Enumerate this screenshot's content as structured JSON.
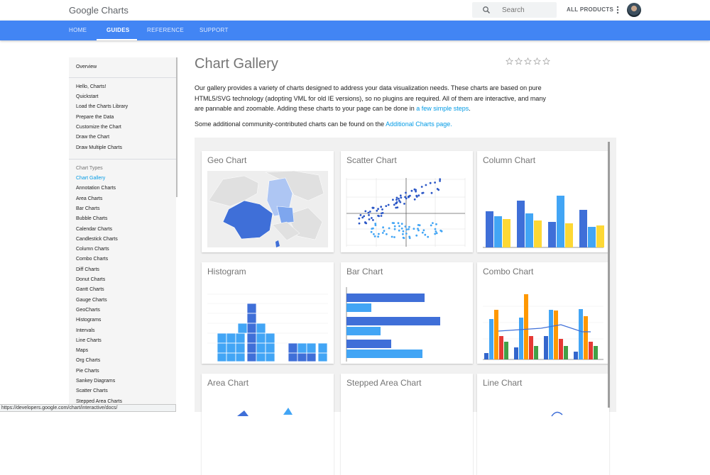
{
  "header": {
    "brand": "Google Charts",
    "search_placeholder": "Search",
    "all_products": "ALL PRODUCTS"
  },
  "nav": {
    "tabs": [
      "HOME",
      "GUIDES",
      "REFERENCE",
      "SUPPORT"
    ],
    "active": "GUIDES"
  },
  "sidebar": {
    "overview": "Overview",
    "section1_head": "Hello, Charts!",
    "section1": [
      "Quickstart",
      "Load the Charts Library",
      "Prepare the Data",
      "Customize the Chart",
      "Draw the Chart",
      "Draw Multiple Charts"
    ],
    "section2_head": "Chart Types",
    "section2": [
      "Chart Gallery",
      "Annotation Charts",
      "Area Charts",
      "Bar Charts",
      "Bubble Charts",
      "Calendar Charts",
      "Candlestick Charts",
      "Column Charts",
      "Combo Charts",
      "Diff Charts",
      "Donut Charts",
      "Gantt Charts",
      "Gauge Charts",
      "GeoCharts",
      "Histograms",
      "Intervals",
      "Line Charts",
      "Maps",
      "Org Charts",
      "Pie Charts",
      "Sankey Diagrams",
      "Scatter Charts",
      "Stepped Area Charts"
    ],
    "active": "Chart Gallery"
  },
  "main": {
    "title": "Chart Gallery",
    "rating_stars": 5,
    "intro_text": "Our gallery provides a variety of charts designed to address your data visualization needs. These charts are based on pure HTML5/SVG technology (adopting VML for old IE versions), so no plugins are required. All of them are interactive, and many are pannable and zoomable. Adding these charts to your page can be done in ",
    "intro_link": "a few simple steps",
    "intro_end": ".",
    "extra_text": "Some additional community-contributed charts can be found on the ",
    "extra_link": "Additional Charts page."
  },
  "gallery": {
    "cards": [
      "Geo Chart",
      "Scatter Chart",
      "Column Chart",
      "Histogram",
      "Bar Chart",
      "Combo Chart",
      "Area Chart",
      "Stepped Area Chart",
      "Line Chart"
    ]
  },
  "status_url": "https://developers.google.com/chart/interactive/docs/",
  "colors": {
    "blue": "#3366cc",
    "light_blue": "#42a5f5",
    "yellow": "#fdd835",
    "orange": "#ff9800",
    "red": "#e53935",
    "green": "#43a047",
    "accent": "#4285f4",
    "link": "#039be5"
  },
  "icons": [
    "search-icon",
    "more-vert-icon",
    "star-outline-icon"
  ]
}
